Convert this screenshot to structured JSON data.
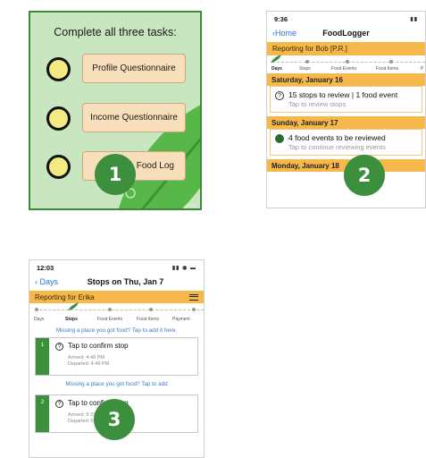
{
  "panel1": {
    "title": "Complete all three tasks:",
    "tasks": [
      {
        "label": "Profile Questionnaire"
      },
      {
        "label": "Income Questionnaire"
      },
      {
        "label": "Food Log"
      }
    ],
    "badge": "1"
  },
  "panel2": {
    "time": "9:36",
    "back_label": "Home",
    "title": "FoodLogger",
    "reporting": "Reporting for Bob [P.R.]",
    "steps": [
      "Days",
      "Stops",
      "Food Events",
      "Food Items",
      "P"
    ],
    "days": [
      {
        "date": "Saturday, January 16",
        "main": "15 stops to review | 1 food event",
        "sub": "Tap to review stops"
      },
      {
        "date": "Sunday, January 17",
        "main": "4 food events to be reviewed",
        "sub": "Tap to continue reviewing events"
      },
      {
        "date": "Monday, January 18"
      }
    ],
    "badge": "2"
  },
  "panel3": {
    "time": "12:03",
    "back_label": "Days",
    "title": "Stops on Thu, Jan 7",
    "reporting": "Reporting for Erika",
    "steps": [
      "Days",
      "Stops",
      "Food Events",
      "Food Items",
      "Payment"
    ],
    "missing_prompt": "Missing a place you got food? Tap to add it here.",
    "missing_prompt_short": "Missing a place you got food? Tap to add",
    "stops": [
      {
        "num": "1",
        "title": "Tap to confirm stop",
        "arrived": "Arrived: 4:48 PM",
        "departed": "Departed: 4:49 PM"
      },
      {
        "num": "2",
        "title": "Tap to confirm stop",
        "arrived": "Arrived: 5:23 PM",
        "departed": "Departed: 5:25 PM"
      }
    ],
    "badge": "3"
  },
  "colors": {
    "accent_orange": "#f6b84a",
    "brand_green": "#3c8f3c",
    "link_blue": "#2277dd"
  }
}
